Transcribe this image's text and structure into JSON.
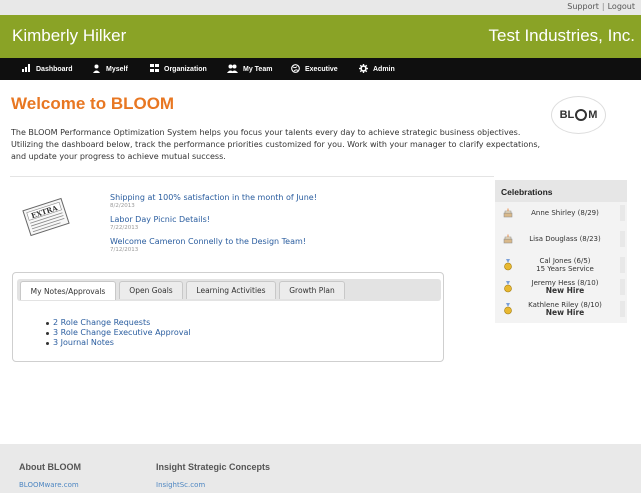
{
  "utility": {
    "support": "Support",
    "logout": "Logout",
    "separator": "|"
  },
  "header": {
    "user_name": "Kimberly Hilker",
    "company": "Test Industries, Inc."
  },
  "nav": {
    "items": [
      {
        "label": "Dashboard",
        "icon": "bar-chart-icon"
      },
      {
        "label": "Myself",
        "icon": "person-icon"
      },
      {
        "label": "Organization",
        "icon": "org-chart-icon"
      },
      {
        "label": "My Team",
        "icon": "team-icon"
      },
      {
        "label": "Executive",
        "icon": "globe-icon"
      },
      {
        "label": "Admin",
        "icon": "gear-icon"
      }
    ]
  },
  "welcome": {
    "title": "Welcome to BLOOM",
    "intro": "The BLOOM Performance Optimization System helps you focus your talents every day to achieve strategic business objectives. Utilizing the dashboard below, track the performance priorities customized for you. Work with your manager to clarify expectations, and update your progress to achieve mutual success.",
    "logo_text_left": "BL",
    "logo_text_right": "M"
  },
  "news": {
    "icon_label": "EXTRA",
    "items": [
      {
        "title": "Shipping at 100% satisfaction in the month of June!",
        "date": "8/2/2013"
      },
      {
        "title": "Labor Day Picnic Details!",
        "date": "7/22/2013"
      },
      {
        "title": "Welcome Cameron Connelly to the Design Team!",
        "date": "7/12/2013"
      }
    ]
  },
  "celebrations": {
    "title": "Celebrations",
    "items": [
      {
        "icon": "cake-icon",
        "text": "Anne Shirley (8/29)",
        "sub": ""
      },
      {
        "icon": "cake-icon",
        "text": "Lisa Douglass (8/23)",
        "sub": ""
      },
      {
        "icon": "medal-icon",
        "text": "Cal Jones (6/5)",
        "sub": "15 Years Service"
      },
      {
        "icon": "medal-icon",
        "text": "Jeremy Hess (8/10)",
        "sub": "New Hire"
      },
      {
        "icon": "medal-icon",
        "text": "Kathlene Riley (8/10)",
        "sub": "New Hire"
      }
    ]
  },
  "tabs": {
    "items": [
      "My Notes/Approvals",
      "Open Goals",
      "Learning Activities",
      "Growth Plan"
    ],
    "active": "My Notes/Approvals",
    "list": [
      "2 Role Change Requests",
      "3 Role Change Executive Approval",
      "3 Journal Notes"
    ]
  },
  "footer": {
    "col1_title": "About BLOOM",
    "col1_link": "BLOOMware.com",
    "col2_title": "Insight Strategic Concepts",
    "col2_link": "InsightSc.com"
  }
}
